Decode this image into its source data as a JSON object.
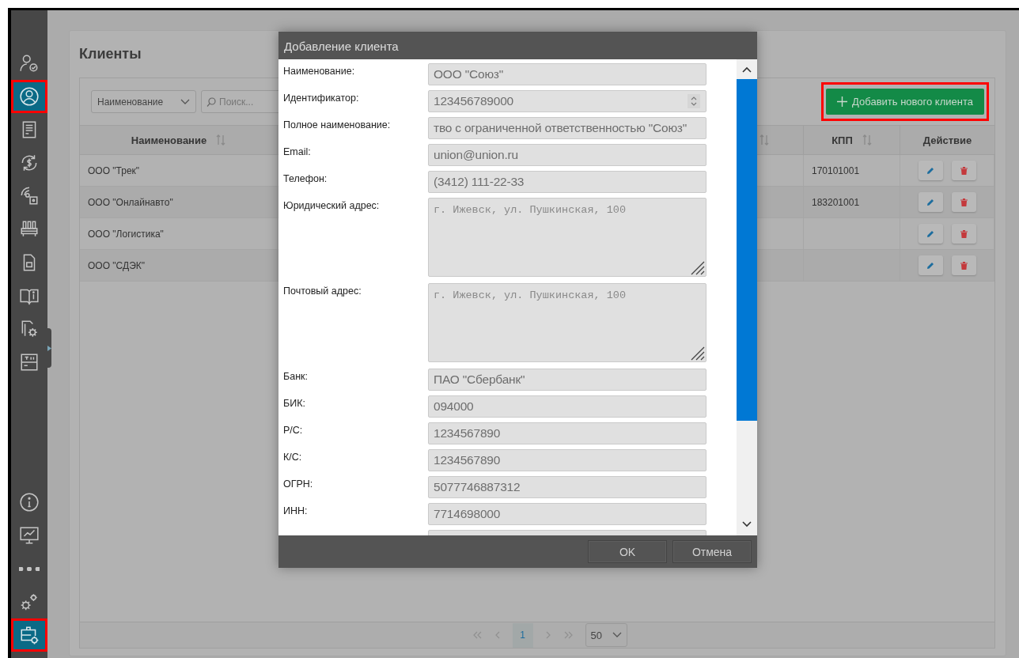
{
  "sidebar": {
    "top_items": [
      {
        "kind": "user-check",
        "selected": false,
        "highlighted": false
      },
      {
        "kind": "user-circle",
        "selected": true,
        "highlighted": true
      },
      {
        "kind": "document",
        "selected": false,
        "highlighted": false
      },
      {
        "kind": "money-cycle",
        "selected": false,
        "highlighted": false
      },
      {
        "kind": "broadcast-lock",
        "selected": false,
        "highlighted": false
      },
      {
        "kind": "server-rack",
        "selected": false,
        "highlighted": false
      },
      {
        "kind": "file",
        "selected": false,
        "highlighted": false
      },
      {
        "kind": "book-info",
        "selected": false,
        "highlighted": false
      },
      {
        "kind": "documents-gear",
        "selected": false,
        "highlighted": false
      },
      {
        "kind": "terminal",
        "selected": false,
        "highlighted": false
      }
    ],
    "bottom_items": [
      {
        "kind": "info",
        "selected": false,
        "highlighted": false
      },
      {
        "kind": "monitor-chart",
        "selected": false,
        "highlighted": false
      },
      {
        "kind": "more",
        "selected": false,
        "highlighted": false
      },
      {
        "kind": "gears",
        "selected": false,
        "highlighted": false
      },
      {
        "kind": "briefcase-gear",
        "selected": true,
        "highlighted": true
      }
    ]
  },
  "page": {
    "title": "Клиенты",
    "filter_field": "Наименование",
    "search_placeholder": "Поиск...",
    "add_button": {
      "label": "Добавить нового клиента",
      "highlighted": true
    }
  },
  "table": {
    "columns": [
      {
        "label": "Наименование",
        "sortable": true
      },
      {
        "sortable": true
      },
      {
        "label": "КПП",
        "sortable": true
      },
      {
        "label": "Действие",
        "sortable": false
      }
    ],
    "rows": [
      {
        "name": "ООО \"Трек\"",
        "kpp": "170101001"
      },
      {
        "name": "ООО \"Онлайнавто\"",
        "kpp": "183201001"
      },
      {
        "name": "ООО \"Логистика\""
      },
      {
        "name": "ООО \"СДЭК\""
      }
    ]
  },
  "pager": {
    "pages": [
      {
        "label": "1",
        "selected": true
      }
    ],
    "page_size": "50"
  },
  "dialog": {
    "title": "Добавление клиента",
    "fields": [
      {
        "kind": "text",
        "label": "Наименование:",
        "value": "ООО \"Союз\""
      },
      {
        "kind": "number",
        "label": "Идентификатор:",
        "value": "123456789000"
      },
      {
        "kind": "text",
        "label": "Полное наименование:",
        "value": "тво с ограниченной ответственностью \"Союз\""
      },
      {
        "kind": "text",
        "label": "Email:",
        "value": "union@union.ru"
      },
      {
        "kind": "text",
        "label": "Телефон:",
        "value": "(3412) 111-22-33"
      },
      {
        "kind": "textarea",
        "label": "Юридический адрес:",
        "value": "г. Ижевск, ул. Пушкинская, 100"
      },
      {
        "kind": "textarea",
        "label": "Почтовый адрес:",
        "value": "г. Ижевск, ул. Пушкинская, 100"
      },
      {
        "kind": "text",
        "label": "Банк:",
        "value": "ПАО \"Сбербанк\""
      },
      {
        "kind": "text",
        "label": "БИК:",
        "value": "094000"
      },
      {
        "kind": "text",
        "label": "Р/С:",
        "value": "1234567890"
      },
      {
        "kind": "text",
        "label": "К/С:",
        "value": "1234567890"
      },
      {
        "kind": "text",
        "label": "ОГРН:",
        "value": "5077746887312"
      },
      {
        "kind": "text",
        "label": "ИНН:",
        "value": "7714698000"
      },
      {
        "kind": "text"
      }
    ],
    "buttons": [
      "OK",
      "Отмена"
    ]
  }
}
